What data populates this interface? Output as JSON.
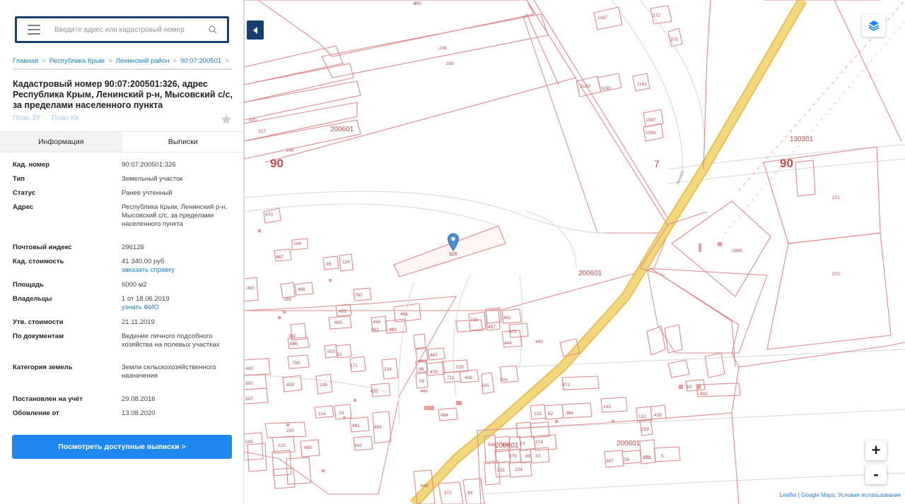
{
  "search": {
    "placeholder": "Введите адрес или кадастровый номер"
  },
  "breadcrumb": [
    "Главная",
    "Республика Крым",
    "Ленинский район",
    "90:07:200501"
  ],
  "breadcrumb_sep": ">",
  "title": "Кадастровый номер 90:07:200501:326, адрес Республика Крым, Ленинский р-н, Мысовский с/с, за пределами населенного пункта",
  "plan_links": [
    "План ЗУ",
    "План КК"
  ],
  "tabs": [
    "Информация",
    "Выписки"
  ],
  "info": [
    {
      "label": "Кад. номер",
      "value": "90:07:200501:326"
    },
    {
      "label": "Тип",
      "value": "Земельный участок"
    },
    {
      "label": "Статус",
      "value": "Ранее учтенный"
    },
    {
      "label": "Адрес",
      "value": "Республика Крым, Ленинский р-н, Мысовский с/с, за пределами населенного пункта"
    },
    {
      "label": "Почтовый индекс",
      "value": "296126"
    },
    {
      "label": "Кад. стоимость",
      "value": "41 340.00 руб",
      "link": "заказать справку"
    },
    {
      "label": "Площадь",
      "value": "6000 м2"
    },
    {
      "label": "Владельцы",
      "value": "1 от 18.06.2019",
      "link": "узнать ФИО"
    },
    {
      "label": "Утв. стоимости",
      "value": "21.11.2019"
    },
    {
      "label": "По документам",
      "value": "Ведение личного подсобного хозяйства на полевых участках"
    },
    {
      "label": "Категория земель",
      "value": "Земли сельскохозяйственного назначения"
    },
    {
      "label": "Постановлен на учёт",
      "value": "29.08.2016"
    },
    {
      "label": "Обовление от",
      "value": "13.08.2020"
    }
  ],
  "extract_button": "Посмотреть доступные выписки >",
  "map": {
    "zoom_in": "+",
    "zoom_out": "-",
    "attribution": {
      "leaflet": "Leaflet",
      "sep": " | ",
      "google": "Google Maps",
      "terms": "Условия использования"
    },
    "big_labels": [
      "90",
      "90",
      "7"
    ],
    "quarter_labels": [
      "200601",
      "200601",
      "130301",
      "200601",
      "200601"
    ],
    "selected_parcel": "326",
    "street_label": "Ленина",
    "parcel_labels": [
      "800",
      "1147",
      "372",
      "375",
      "236",
      "288",
      "1150",
      "1190",
      "1161",
      "1087",
      "1086",
      "320",
      "317",
      "240",
      "371",
      "1885",
      "372",
      "470",
      "144",
      "467",
      "99",
      "124",
      "480",
      "466",
      "767",
      "169",
      "493",
      "485",
      "494",
      "482",
      "483",
      "466",
      "715",
      "457",
      "441",
      "472",
      "440",
      "444",
      "392",
      "986",
      "789",
      "503",
      "22",
      "171",
      "234",
      "455",
      "98",
      "59",
      "446",
      "447",
      "478",
      "528",
      "711",
      "438",
      "145",
      "504",
      "469",
      "800",
      "507",
      "459",
      "235",
      "431",
      "471",
      "63",
      "402",
      "114",
      "14",
      "491",
      "486",
      "442",
      "484",
      "132",
      "62",
      "364",
      "143",
      "151",
      "209",
      "439",
      "230",
      "505",
      "120",
      "499",
      "546",
      "546",
      "13",
      "274",
      "379",
      "89",
      "33",
      "124",
      "133",
      "367",
      "56",
      "171",
      "5",
      "666",
      "372",
      "94",
      "651",
      "90"
    ]
  },
  "colors": {
    "parcel_line": "#e0898a",
    "parcel_fill": "#fdf3f3",
    "road": "#f2d77c",
    "road_edge": "#e8c055",
    "accent": "#1e88f0",
    "navy": "#163e6e"
  }
}
